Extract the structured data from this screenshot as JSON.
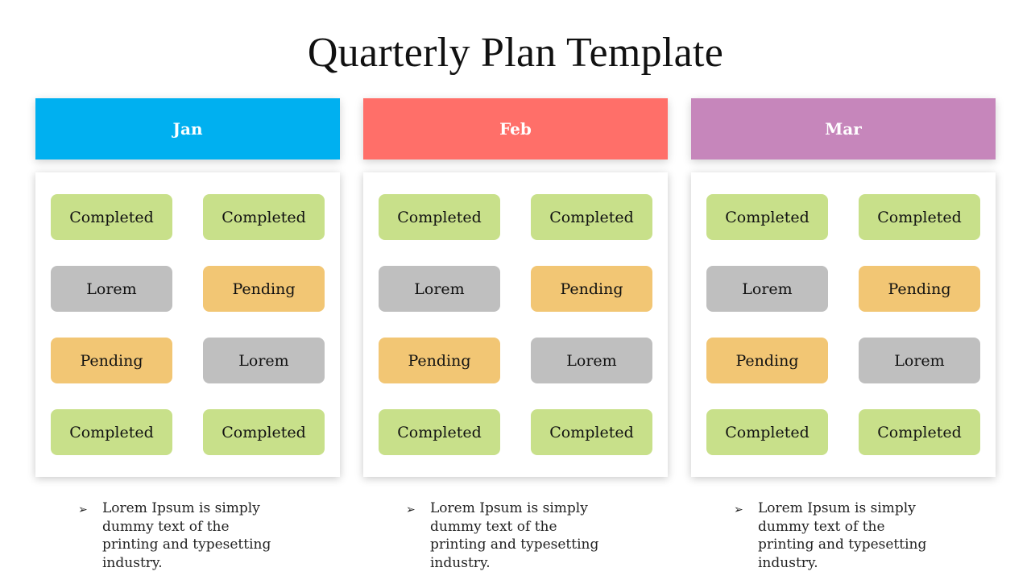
{
  "title": "Quarterly Plan Template",
  "colors": {
    "completed": "#c8e08a",
    "pending": "#f2c674",
    "lorem": "#bfbfbf"
  },
  "columns": [
    {
      "month": "Jan",
      "color": "#00b0f0",
      "items": [
        "Completed",
        "Completed",
        "Lorem",
        "Pending",
        "Pending",
        "Lorem",
        "Completed",
        "Completed"
      ],
      "note": "Lorem Ipsum is simply dummy text of the printing and typesetting industry."
    },
    {
      "month": "Feb",
      "color": "#ff6f69",
      "items": [
        "Completed",
        "Completed",
        "Lorem",
        "Pending",
        "Pending",
        "Lorem",
        "Completed",
        "Completed"
      ],
      "note": "Lorem Ipsum is simply dummy text of the printing and typesetting industry."
    },
    {
      "month": "Mar",
      "color": "#c686bb",
      "items": [
        "Completed",
        "Completed",
        "Lorem",
        "Pending",
        "Pending",
        "Lorem",
        "Completed",
        "Completed"
      ],
      "note": "Lorem Ipsum is simply dummy text of the printing and typesetting industry."
    }
  ],
  "bullet_icon": "➢"
}
